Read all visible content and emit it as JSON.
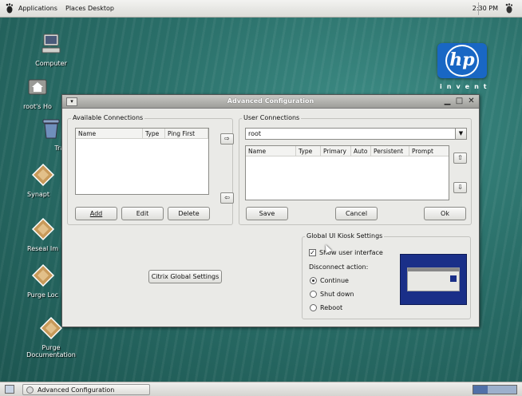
{
  "top_panel": {
    "menus": [
      "Applications",
      "Places",
      "Desktop"
    ],
    "clock": "2:30 PM"
  },
  "desktop": {
    "icons": [
      {
        "label": "Computer",
        "icon": "computer-icon"
      },
      {
        "label": "root's Ho",
        "icon": "home-folder-icon"
      },
      {
        "label": "Trash",
        "icon": "trash-icon"
      },
      {
        "label": "Synapt",
        "icon": "package-icon"
      },
      {
        "label": "Reseal Im",
        "icon": "package-icon"
      },
      {
        "label": "Purge Loc",
        "icon": "package-icon"
      },
      {
        "label": "Purge Documentation",
        "icon": "package-icon"
      }
    ],
    "logo_text": "hp",
    "logo_tagline": "invent"
  },
  "dialog": {
    "title": "Advanced Configuration",
    "available": {
      "title": "Available Connections",
      "columns": [
        "Name",
        "Type",
        "Ping First"
      ],
      "rows": [],
      "buttons": {
        "add": "Add",
        "edit": "Edit",
        "delete": "Delete"
      }
    },
    "user": {
      "title": "User Connections",
      "selected_user": "root",
      "columns": [
        "Name",
        "Type",
        "Primary",
        "Auto",
        "Persistent",
        "Prompt"
      ],
      "rows": [],
      "buttons": {
        "save": "Save",
        "cancel": "Cancel",
        "ok": "Ok"
      }
    },
    "citrix_button": "Citrix Global Settings",
    "kiosk": {
      "title": "Global UI Kiosk Settings",
      "show_ui_label": "Show user interface",
      "show_ui_checked": true,
      "disconnect_label": "Disconnect action:",
      "options": [
        "Continue",
        "Shut down",
        "Reboot"
      ],
      "selected_option": "Continue"
    }
  },
  "taskbar": {
    "task_label": "Advanced Configuration"
  },
  "colors": {
    "desktop": "#2a6f69",
    "hp_blue": "#1967c4",
    "titlebar": "#9d9d99",
    "preview_blue": "#1a2f88"
  }
}
